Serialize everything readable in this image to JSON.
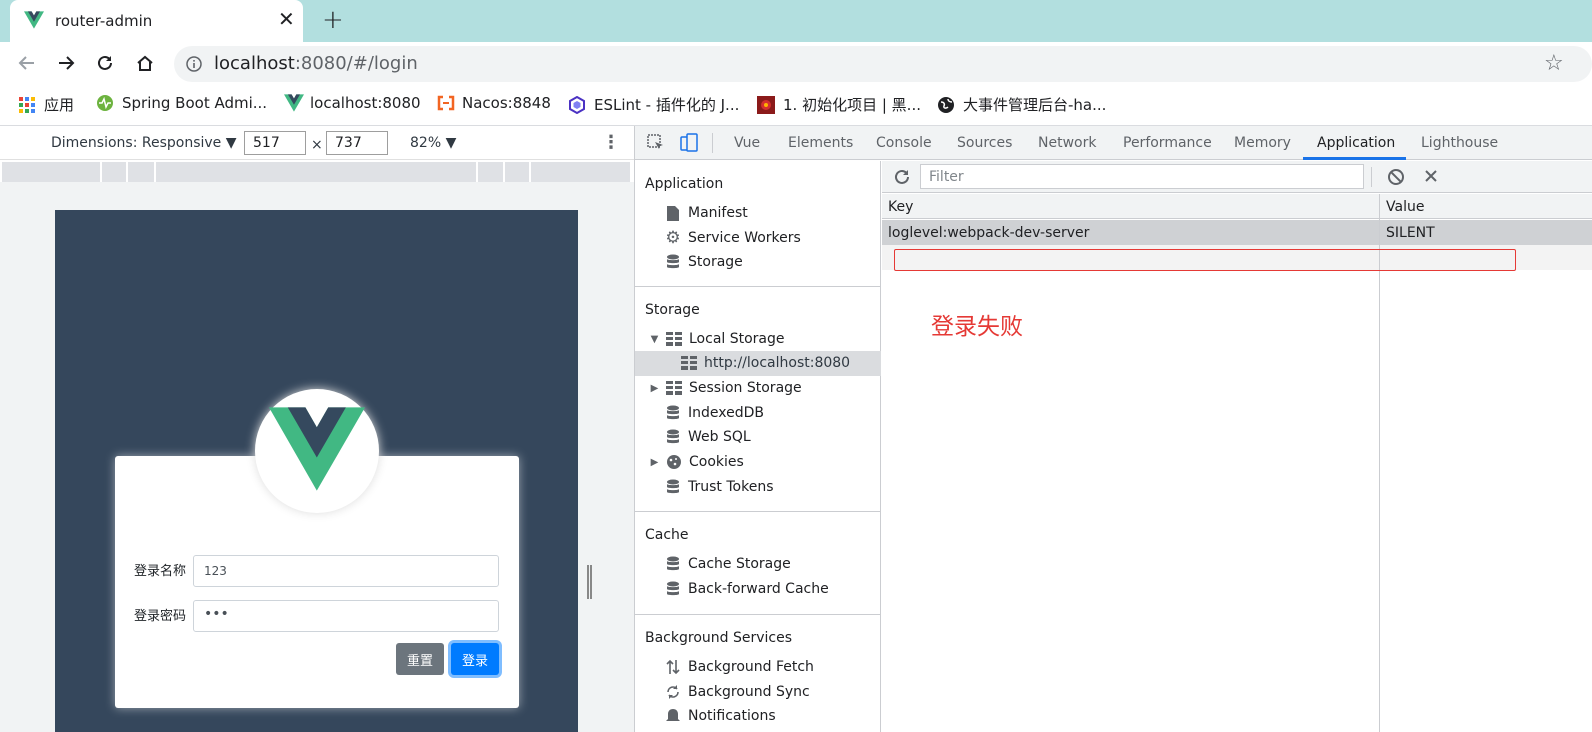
{
  "browser": {
    "tab_title": "router-admin",
    "close": "✕",
    "new_tab": "+",
    "url_host": "localhost",
    "url_rest": ":8080/#/login"
  },
  "bookmarks": [
    {
      "label": "应用"
    },
    {
      "label": "Spring Boot Admi..."
    },
    {
      "label": "localhost:8080"
    },
    {
      "label": "Nacos:8848"
    },
    {
      "label": "ESLint - 插件化的 J..."
    },
    {
      "label": "1. 初始化项目 | 黑..."
    },
    {
      "label": "大事件管理后台-ha..."
    }
  ],
  "device_toolbar": {
    "dimensions": "Dimensions: Responsive ▼",
    "width": "517",
    "times": "×",
    "height": "737",
    "zoom": "82% ▼"
  },
  "login": {
    "name_label": "登录名称",
    "name_value": "123",
    "pwd_label": "登录密码",
    "pwd_value": "•••",
    "reset": "重置",
    "submit": "登录"
  },
  "devtools": {
    "tabs": [
      "Vue",
      "Elements",
      "Console",
      "Sources",
      "Network",
      "Performance",
      "Memory",
      "Application",
      "Lighthouse"
    ],
    "active_tab": "Application",
    "sections": {
      "application": {
        "title": "Application",
        "items": [
          "Manifest",
          "Service Workers",
          "Storage"
        ]
      },
      "storage": {
        "title": "Storage",
        "items": [
          "Local Storage",
          "http://localhost:8080",
          "Session Storage",
          "IndexedDB",
          "Web SQL",
          "Cookies",
          "Trust Tokens"
        ]
      },
      "cache": {
        "title": "Cache",
        "items": [
          "Cache Storage",
          "Back-forward Cache"
        ]
      },
      "background": {
        "title": "Background Services",
        "items": [
          "Background Fetch",
          "Background Sync",
          "Notifications"
        ]
      }
    },
    "filter_placeholder": "Filter",
    "table": {
      "key_header": "Key",
      "value_header": "Value",
      "rows": [
        {
          "key": "loglevel:webpack-dev-server",
          "value": "SILENT"
        }
      ]
    },
    "annotation": "登录失败",
    "annotation_color": "#e53935"
  },
  "colors": {
    "tabstrip": "#b2dfdf",
    "page_bg": "#35475c",
    "accent": "#1a73e8",
    "vue_green": "#41b883",
    "vue_dark": "#35495e"
  }
}
